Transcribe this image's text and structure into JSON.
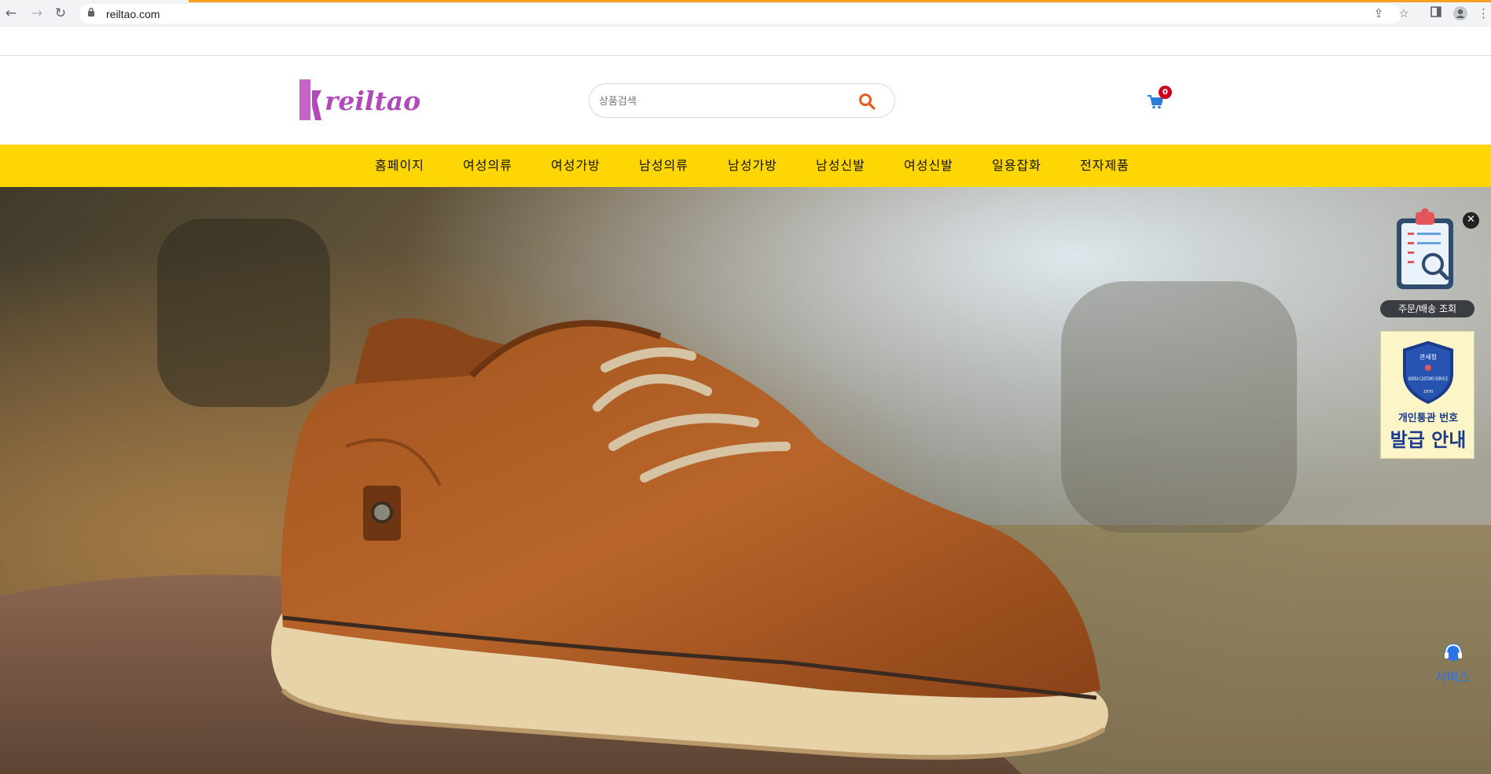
{
  "browser": {
    "url": "reiltao.com",
    "icons": [
      "back-icon",
      "forward-icon",
      "reload-icon",
      "lock-icon",
      "share-icon",
      "star-icon",
      "side-panel-icon",
      "profile-icon",
      "more-icon"
    ]
  },
  "header": {
    "logo_text": "reiltao",
    "search": {
      "placeholder": "상품검색",
      "value": ""
    },
    "cart_count": "0",
    "colors": {
      "logo": "#b04ab8",
      "search_icon": "#e85a1b",
      "cart_icon": "#2d7bd8",
      "badge": "#d0021b"
    }
  },
  "menu": {
    "background": "#fed604",
    "items": [
      {
        "label": "홈페이지"
      },
      {
        "label": "여성의류"
      },
      {
        "label": "여성가방"
      },
      {
        "label": "남성의류"
      },
      {
        "label": "남성가방"
      },
      {
        "label": "남성신발"
      },
      {
        "label": "여성신발"
      },
      {
        "label": "일용잡화"
      },
      {
        "label": "전자제품"
      }
    ]
  },
  "hero": {
    "subject": "brown leather lace-up shoe on a rock"
  },
  "floating": {
    "order_lookup_label": "주문/배송 조회",
    "customs": {
      "badge_top": "관세청",
      "badge_mid": "KOREA CUSTOMS SERVICE",
      "badge_year": "1970",
      "line1": "개인통관 번호",
      "line2": "발급 안내"
    },
    "service_label": "서비스"
  }
}
